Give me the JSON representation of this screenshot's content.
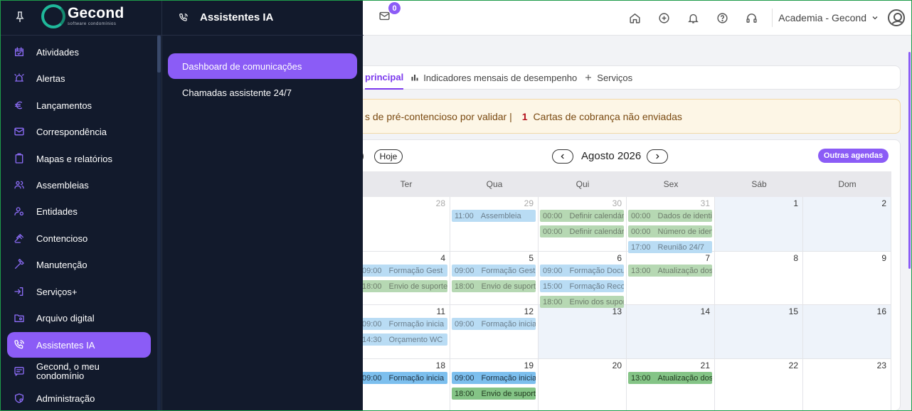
{
  "topbar": {
    "mail_badge": "0",
    "org_name": "Academia - Gecond",
    "icons": [
      "home-icon",
      "plus-circle-icon",
      "bell-icon",
      "help-icon",
      "headset-icon"
    ]
  },
  "sidebar": {
    "logo_word": "Gecond",
    "logo_sub": "software condomínios",
    "items": [
      {
        "label": "Atividades",
        "icon": "calendar-check-icon"
      },
      {
        "label": "Alertas",
        "icon": "alarm-icon"
      },
      {
        "label": "Lançamentos",
        "icon": "euro-icon"
      },
      {
        "label": "Correspondência",
        "icon": "mail-icon"
      },
      {
        "label": "Mapas e relatórios",
        "icon": "clipboard-icon"
      },
      {
        "label": "Assembleias",
        "icon": "users-icon"
      },
      {
        "label": "Entidades",
        "icon": "user-gear-icon"
      },
      {
        "label": "Contencioso",
        "icon": "gavel-icon"
      },
      {
        "label": "Manutenção",
        "icon": "wrench-icon"
      },
      {
        "label": "Serviços+",
        "icon": "login-icon"
      },
      {
        "label": "Arquivo digital",
        "icon": "folder-icon"
      },
      {
        "label": "Assistentes IA",
        "icon": "phone-icon",
        "active": true
      },
      {
        "label": "Gecond, o meu condomínio",
        "icon": "chat-icon"
      },
      {
        "label": "Administração",
        "icon": "shield-gear-icon"
      }
    ]
  },
  "submenu": {
    "title": "Assistentes IA",
    "items": [
      {
        "label": "Dashboard de comunicações",
        "active": true
      },
      {
        "label": "Chamadas assistente 24/7"
      }
    ]
  },
  "tabs": [
    {
      "label": "principal",
      "active": true
    },
    {
      "label": "Indicadores mensais de desempenho",
      "icon": "bar-chart-icon"
    },
    {
      "label": "Serviços",
      "icon": "plus-icon"
    }
  ],
  "alert": {
    "text1": "s de pré-contencioso por validar |",
    "count": "1",
    "text2": "Cartas de cobrança não enviadas"
  },
  "calendar": {
    "today_btn": "Hoje",
    "month": "Agosto 2026",
    "other_agendas": "Outras agendas",
    "dow": [
      "Ter",
      "Qua",
      "Qui",
      "Sex",
      "Sáb",
      "Dom"
    ],
    "weeks": [
      {
        "days": [
          "28",
          "29",
          "30",
          "31",
          "1",
          "2"
        ],
        "dim": [
          true,
          true,
          true,
          true,
          false,
          false
        ]
      },
      {
        "days": [
          "4",
          "5",
          "6",
          "7",
          "8",
          "9"
        ]
      },
      {
        "days": [
          "11",
          "12",
          "13",
          "14",
          "15",
          "16"
        ]
      },
      {
        "days": [
          "18",
          "19",
          "20",
          "21",
          "22",
          "23"
        ]
      }
    ],
    "events": [
      {
        "week": 0,
        "col": 1,
        "row": 0,
        "time": "11:00",
        "title": "Assembleia",
        "color": "blue"
      },
      {
        "week": 0,
        "col": 2,
        "row": 0,
        "time": "00:00",
        "title": "Definir calendár",
        "color": "green"
      },
      {
        "week": 0,
        "col": 2,
        "row": 1,
        "time": "00:00",
        "title": "Definir calendár",
        "color": "green"
      },
      {
        "week": 0,
        "col": 3,
        "row": 0,
        "time": "00:00",
        "title": "Dados de identi",
        "color": "green"
      },
      {
        "week": 0,
        "col": 3,
        "row": 1,
        "time": "00:00",
        "title": "Número de iden",
        "color": "green"
      },
      {
        "week": 0,
        "col": 3,
        "row": 2,
        "time": "17:00",
        "title": "Reunião 24/7",
        "color": "blue"
      },
      {
        "week": 1,
        "col": 0,
        "row": 0,
        "time": "09:00",
        "title": "Formação Gest",
        "color": "blue"
      },
      {
        "week": 1,
        "col": 0,
        "row": 1,
        "time": "18:00",
        "title": "Envio de suporte",
        "color": "green"
      },
      {
        "week": 1,
        "col": 1,
        "row": 0,
        "time": "09:00",
        "title": "Formação Gest",
        "color": "blue"
      },
      {
        "week": 1,
        "col": 1,
        "row": 1,
        "time": "18:00",
        "title": "Envio de suporte",
        "color": "green"
      },
      {
        "week": 1,
        "col": 2,
        "row": 0,
        "time": "09:00",
        "title": "Formação Docu",
        "color": "blue"
      },
      {
        "week": 1,
        "col": 2,
        "row": 1,
        "time": "15:00",
        "title": "Formação Reco",
        "color": "blue"
      },
      {
        "week": 1,
        "col": 2,
        "row": 2,
        "time": "18:00",
        "title": "Envio dos supor",
        "color": "green"
      },
      {
        "week": 1,
        "col": 3,
        "row": 0,
        "time": "13:00",
        "title": "Atualização dos",
        "color": "green"
      },
      {
        "week": 2,
        "col": 0,
        "row": 0,
        "time": "09:00",
        "title": "Formação inicia",
        "color": "blue"
      },
      {
        "week": 2,
        "col": 0,
        "row": 1,
        "time": "14:30",
        "title": "Orçamento WC",
        "color": "blue"
      },
      {
        "week": 2,
        "col": 1,
        "row": 0,
        "time": "09:00",
        "title": "Formação inicia",
        "color": "blue"
      },
      {
        "week": 3,
        "col": 0,
        "row": 0,
        "time": "09:00",
        "title": "Formação inicia",
        "color": "blue",
        "strong": true
      },
      {
        "week": 3,
        "col": 1,
        "row": 0,
        "time": "09:00",
        "title": "Formação inicia",
        "color": "blue",
        "strong": true
      },
      {
        "week": 3,
        "col": 1,
        "row": 1,
        "time": "18:00",
        "title": "Envio de suporte",
        "color": "green",
        "strong": true
      },
      {
        "week": 3,
        "col": 3,
        "row": 0,
        "time": "13:00",
        "title": "Atualização dos",
        "color": "green",
        "strong": true
      }
    ]
  }
}
